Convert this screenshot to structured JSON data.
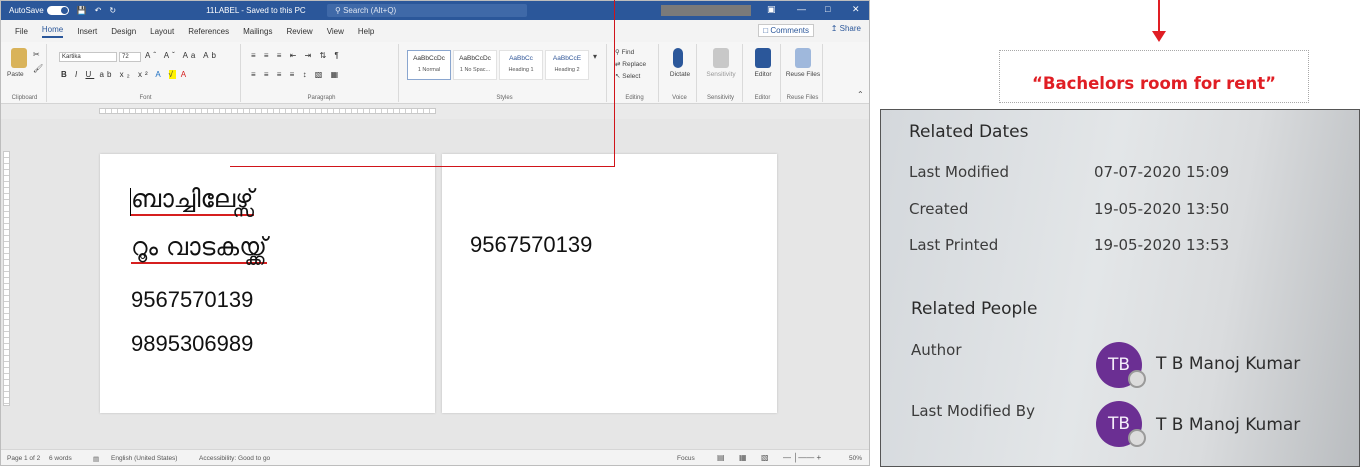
{
  "word": {
    "titlebar": {
      "autosave_label": "AutoSave",
      "autosave_state": "Off",
      "doc_title": "11LABEL - Saved to this PC",
      "search_placeholder": "Search (Alt+Q)"
    },
    "menu": [
      "File",
      "Home",
      "Insert",
      "Design",
      "Layout",
      "References",
      "Mailings",
      "Review",
      "View",
      "Help"
    ],
    "menu_active": "Home",
    "comments_label": "Comments",
    "share_label": "Share",
    "ribbon": {
      "paste_label": "Paste",
      "font_name": "Kartika",
      "font_size": "72",
      "groups": [
        "Clipboard",
        "Font",
        "Paragraph",
        "Styles",
        "Editing",
        "Voice",
        "Sensitivity",
        "Editor",
        "Reuse Files"
      ],
      "styles": [
        {
          "preview": "AaBbCcDc",
          "name": "1 Normal"
        },
        {
          "preview": "AaBbCcDc",
          "name": "1 No Spac..."
        },
        {
          "preview": "AaBbCc",
          "name": "Heading 1"
        },
        {
          "preview": "AaBbCcE",
          "name": "Heading 2"
        }
      ],
      "editing": [
        "Find",
        "Replace",
        "Select"
      ],
      "dictate_label": "Dictate",
      "sensitivity_label": "Sensitivity",
      "editor_label": "Editor",
      "reuse_label": "Reuse Files"
    },
    "page1": {
      "line1": "ബാച്ചിലേഴ്സ്",
      "line2": "റൂം വാടകയ്ക്ക്",
      "phone1": "9567570139",
      "phone2": "9895306989"
    },
    "page2": {
      "phone": "9567570139"
    },
    "status": {
      "page": "Page 1 of 2",
      "words": "6 words",
      "language": "English (United States)",
      "accessibility": "Accessibility: Good to go",
      "focus": "Focus",
      "zoom": "50%"
    }
  },
  "annotation": {
    "callout_text": "“Bachelors room for rent”",
    "line_color": "#d0141a"
  },
  "properties": {
    "dates_heading": "Related Dates",
    "dates": [
      {
        "label": "Last Modified",
        "value": "07-07-2020 15:09"
      },
      {
        "label": "Created",
        "value": "19-05-2020 13:50"
      },
      {
        "label": "Last Printed",
        "value": "19-05-2020 13:53"
      }
    ],
    "people_heading": "Related People",
    "people": [
      {
        "label": "Author",
        "initials": "TB",
        "name": "T B Manoj Kumar"
      },
      {
        "label": "Last Modified By",
        "initials": "TB",
        "name": "T B Manoj Kumar"
      }
    ],
    "avatar_color": "#6b2f93"
  }
}
